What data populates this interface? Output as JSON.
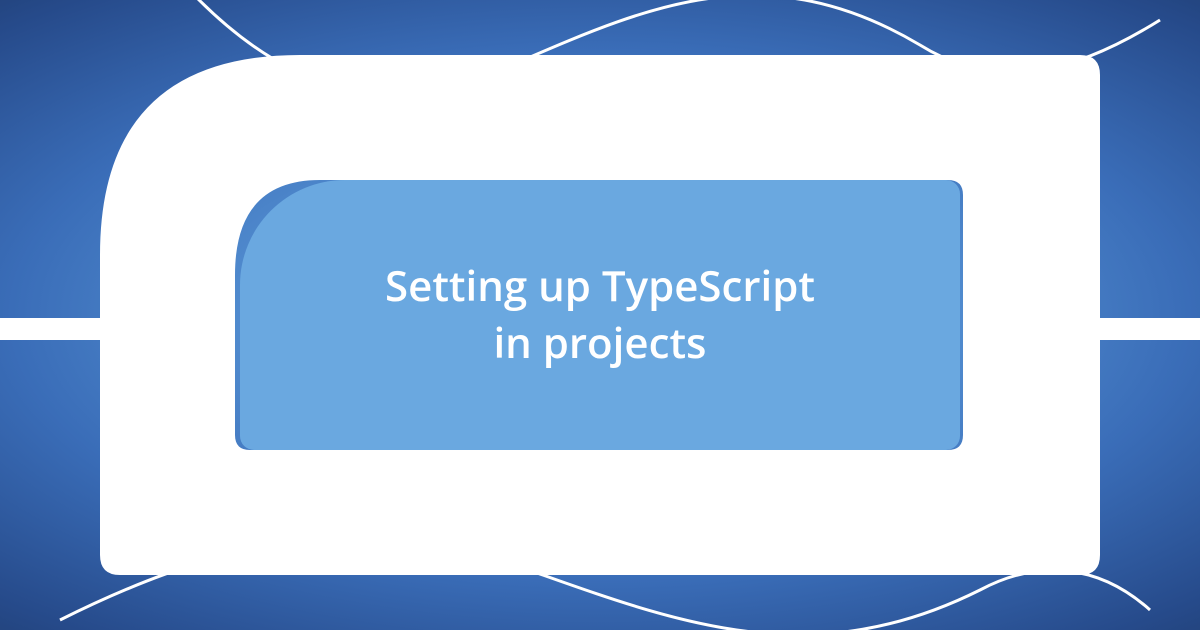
{
  "card": {
    "title_line1": "Setting up TypeScript",
    "title_line2": "in projects"
  },
  "colors": {
    "inner_panel": "#6aa8e0",
    "frame": "#ffffff",
    "text": "#ffffff"
  }
}
